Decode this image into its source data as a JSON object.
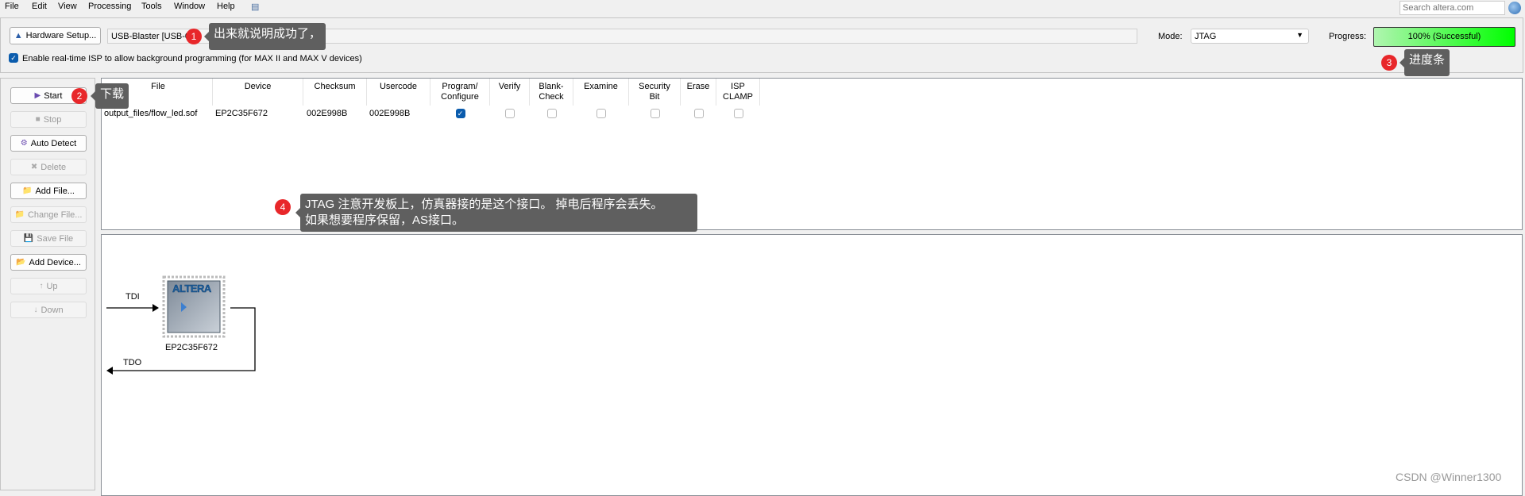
{
  "menu": [
    "File",
    "Edit",
    "View",
    "Processing",
    "Tools",
    "Window",
    "Help"
  ],
  "search": {
    "placeholder": "Search altera.com"
  },
  "hardware": {
    "button": "Hardware Setup...",
    "value": "USB-Blaster [USB-0]"
  },
  "isp_checkbox": {
    "label": "Enable real-time ISP to allow background programming (for MAX II and MAX V devices)",
    "checked": true
  },
  "mode": {
    "label": "Mode:",
    "value": "JTAG"
  },
  "progress": {
    "label": "Progress:",
    "text": "100% (Successful)",
    "percent": 100,
    "color": "#00ff00"
  },
  "buttons": [
    {
      "label": "Start",
      "enabled": true
    },
    {
      "label": "Stop",
      "enabled": false
    },
    {
      "label": "Auto Detect",
      "enabled": true
    },
    {
      "label": "Delete",
      "enabled": false
    },
    {
      "label": "Add File...",
      "enabled": true
    },
    {
      "label": "Change File...",
      "enabled": false
    },
    {
      "label": "Save File",
      "enabled": false
    },
    {
      "label": "Add Device...",
      "enabled": true
    },
    {
      "label": "Up",
      "enabled": false
    },
    {
      "label": "Down",
      "enabled": false
    }
  ],
  "table": {
    "headers": [
      "File",
      "Device",
      "Checksum",
      "Usercode",
      "Program/\nConfigure",
      "Verify",
      "Blank-\nCheck",
      "Examine",
      "Security\nBit",
      "Erase",
      "ISP\nCLAMP"
    ],
    "rows": [
      {
        "file": "output_files/flow_led.sof",
        "device": "EP2C35F672",
        "checksum": "002E998B",
        "usercode": "002E998B",
        "checks": [
          true,
          false,
          false,
          false,
          false,
          false,
          false
        ]
      }
    ]
  },
  "diagram": {
    "tdi": "TDI",
    "tdo": "TDO",
    "device": "EP2C35F672",
    "logo": "ALTERA"
  },
  "annotations": [
    {
      "n": "1",
      "text": "出来就说明成功了，"
    },
    {
      "n": "2",
      "text": "下载"
    },
    {
      "n": "3",
      "text": "进度条"
    },
    {
      "n": "4",
      "text": "JTAG 注意开发板上，仿真器接的是这个接口。 掉电后程序会丢失。\n如果想要程序保留，AS接口。"
    }
  ],
  "watermark": "CSDN @Winner1300"
}
